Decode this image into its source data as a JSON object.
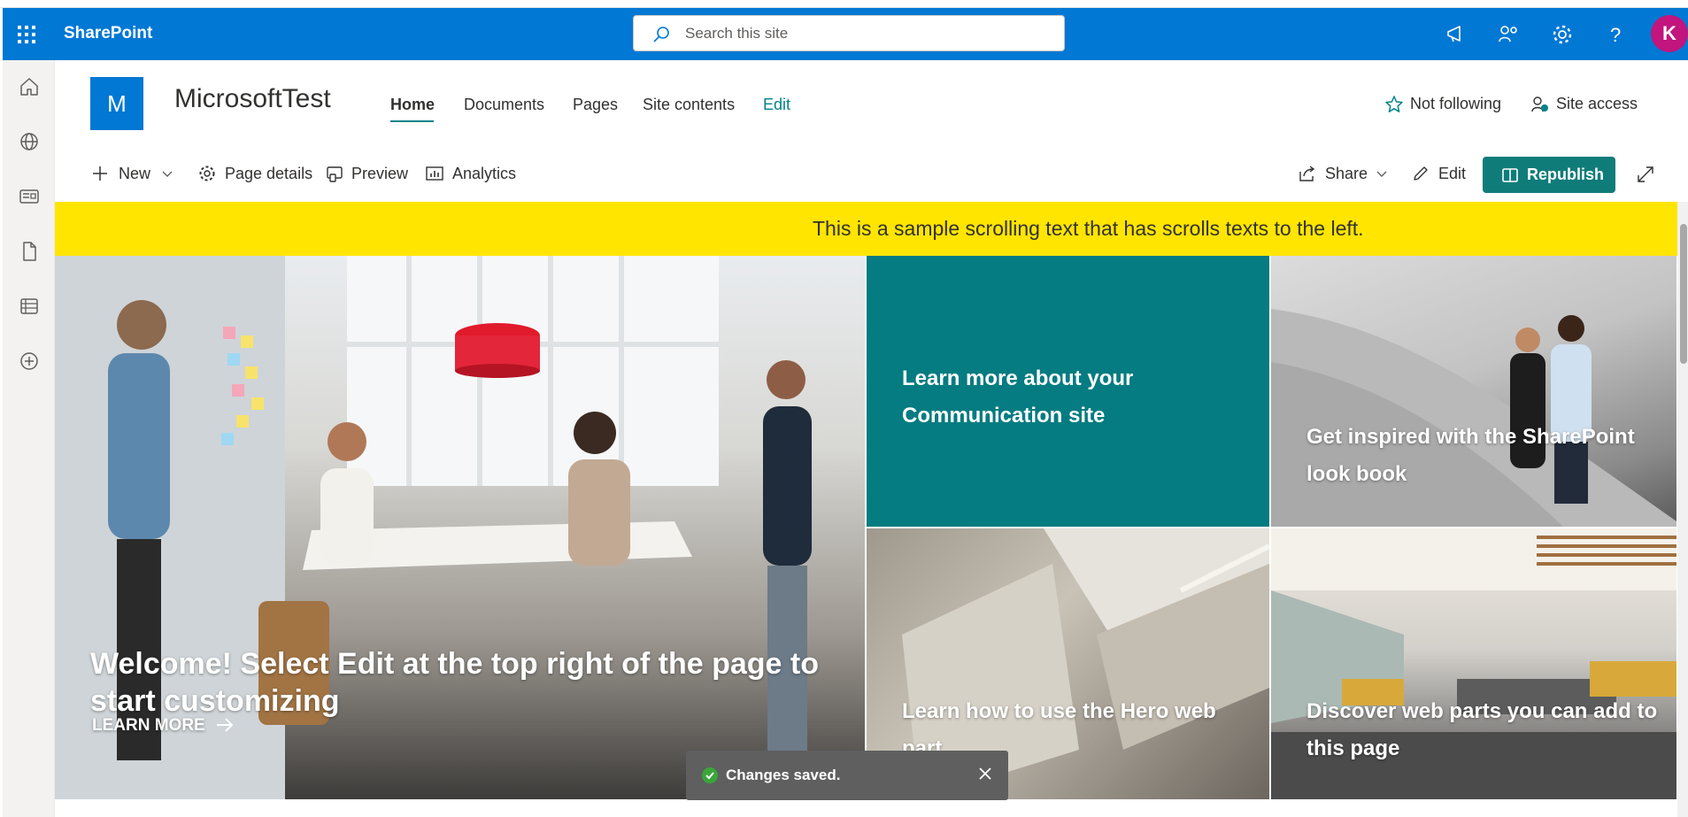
{
  "suite": {
    "app_name": "SharePoint",
    "search_placeholder": "Search this site",
    "avatar_initial": "K"
  },
  "site": {
    "logo_letter": "M",
    "title": "MicrosoftTest",
    "nav": [
      "Home",
      "Documents",
      "Pages",
      "Site contents",
      "Edit"
    ],
    "follow_label": "Not following",
    "access_label": "Site access"
  },
  "commands": {
    "new": "New",
    "page_details": "Page details",
    "preview": "Preview",
    "analytics": "Analytics",
    "share": "Share",
    "edit": "Edit",
    "republish": "Republish"
  },
  "banner": {
    "text": "This is a sample scrolling text that has scrolls texts to the left.",
    "color": "#ffe500"
  },
  "hero": {
    "main_title": "Welcome! Select Edit at the top right of the page to start customizing",
    "main_link": "LEARN MORE",
    "tiles": [
      "Learn more about your Communication site",
      "Get inspired with the SharePoint look book",
      "Learn how to use the Hero web part",
      "Discover web parts you can add to this page"
    ]
  },
  "toast": {
    "message": "Changes saved."
  },
  "colors": {
    "suitebar": "#0078d4",
    "accent_teal": "#038387",
    "tile_teal": "#047c81"
  }
}
